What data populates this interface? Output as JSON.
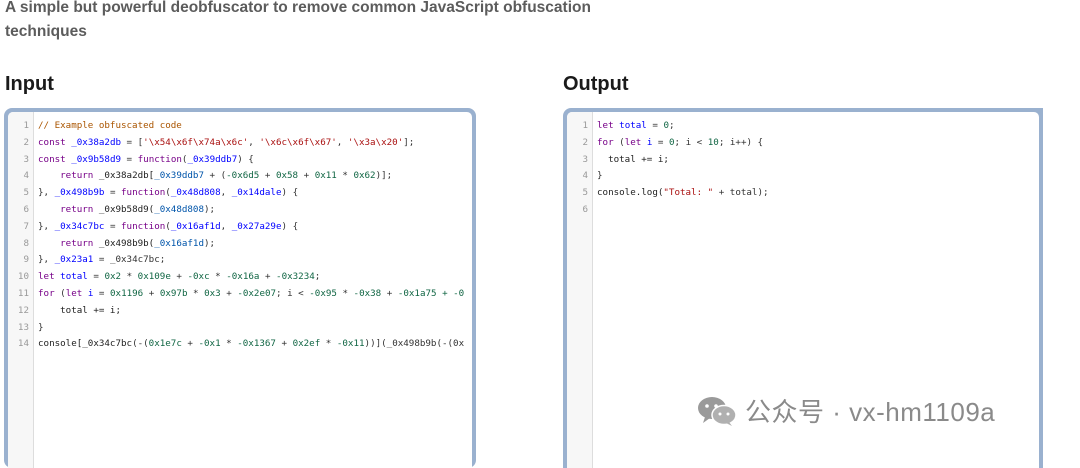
{
  "subtitle": "A simple but powerful deobfuscator to remove common JavaScript obfuscation techniques",
  "input_panel": {
    "heading": "Input",
    "line_numbers": [
      "1",
      "2",
      "3",
      "4",
      "5",
      "6",
      "7",
      "8",
      "9",
      "10",
      "11",
      "12",
      "13",
      "14"
    ],
    "lines": [
      [
        {
          "t": "// Example obfuscated code",
          "c": "com"
        }
      ],
      [
        {
          "t": "const",
          "c": "kw"
        },
        {
          "t": " ",
          "c": "pun"
        },
        {
          "t": "_0x38a2db",
          "c": "def"
        },
        {
          "t": " = [",
          "c": "pun"
        },
        {
          "t": "'\\x54\\x6f\\x74a\\x6c'",
          "c": "str"
        },
        {
          "t": ", ",
          "c": "pun"
        },
        {
          "t": "'\\x6c\\x6f\\x67'",
          "c": "str"
        },
        {
          "t": ", ",
          "c": "pun"
        },
        {
          "t": "'\\x3a\\x20'",
          "c": "str"
        },
        {
          "t": "];",
          "c": "pun"
        }
      ],
      [
        {
          "t": "const",
          "c": "kw"
        },
        {
          "t": " ",
          "c": "pun"
        },
        {
          "t": "_0x9b58d9",
          "c": "def"
        },
        {
          "t": " = ",
          "c": "pun"
        },
        {
          "t": "function",
          "c": "kw"
        },
        {
          "t": "(",
          "c": "pun"
        },
        {
          "t": "_0x39ddb7",
          "c": "def"
        },
        {
          "t": ") {",
          "c": "pun"
        }
      ],
      [
        {
          "t": "    ",
          "c": "pun"
        },
        {
          "t": "return",
          "c": "kw"
        },
        {
          "t": " _0x38a2db[",
          "c": "var"
        },
        {
          "t": "_0x39ddb7",
          "c": "var2"
        },
        {
          "t": " + (",
          "c": "pun"
        },
        {
          "t": "-0x6d5",
          "c": "num"
        },
        {
          "t": " + ",
          "c": "pun"
        },
        {
          "t": "0x58",
          "c": "num"
        },
        {
          "t": " + ",
          "c": "pun"
        },
        {
          "t": "0x11",
          "c": "num"
        },
        {
          "t": " * ",
          "c": "pun"
        },
        {
          "t": "0x62",
          "c": "num"
        },
        {
          "t": ")];",
          "c": "pun"
        }
      ],
      [
        {
          "t": "}, ",
          "c": "pun"
        },
        {
          "t": "_0x498b9b",
          "c": "def"
        },
        {
          "t": " = ",
          "c": "pun"
        },
        {
          "t": "function",
          "c": "kw"
        },
        {
          "t": "(",
          "c": "pun"
        },
        {
          "t": "_0x48d808",
          "c": "def"
        },
        {
          "t": ", ",
          "c": "pun"
        },
        {
          "t": "_0x14dale",
          "c": "def"
        },
        {
          "t": ") {",
          "c": "pun"
        }
      ],
      [
        {
          "t": "    ",
          "c": "pun"
        },
        {
          "t": "return",
          "c": "kw"
        },
        {
          "t": " _0x9b58d9(",
          "c": "var"
        },
        {
          "t": "_0x48d808",
          "c": "var2"
        },
        {
          "t": ");",
          "c": "pun"
        }
      ],
      [
        {
          "t": "}, ",
          "c": "pun"
        },
        {
          "t": "_0x34c7bc",
          "c": "def"
        },
        {
          "t": " = ",
          "c": "pun"
        },
        {
          "t": "function",
          "c": "kw"
        },
        {
          "t": "(",
          "c": "pun"
        },
        {
          "t": "_0x16af1d",
          "c": "def"
        },
        {
          "t": ", ",
          "c": "pun"
        },
        {
          "t": "_0x27a29e",
          "c": "def"
        },
        {
          "t": ") {",
          "c": "pun"
        }
      ],
      [
        {
          "t": "    ",
          "c": "pun"
        },
        {
          "t": "return",
          "c": "kw"
        },
        {
          "t": " _0x498b9b(",
          "c": "var"
        },
        {
          "t": "_0x16af1d",
          "c": "var2"
        },
        {
          "t": ");",
          "c": "pun"
        }
      ],
      [
        {
          "t": "}, ",
          "c": "pun"
        },
        {
          "t": "_0x23a1",
          "c": "def"
        },
        {
          "t": " = _0x34c7bc;",
          "c": "pun"
        }
      ],
      [
        {
          "t": "let",
          "c": "kw"
        },
        {
          "t": " ",
          "c": "pun"
        },
        {
          "t": "total",
          "c": "def"
        },
        {
          "t": " = ",
          "c": "pun"
        },
        {
          "t": "0x2",
          "c": "num"
        },
        {
          "t": " * ",
          "c": "pun"
        },
        {
          "t": "0x109e",
          "c": "num"
        },
        {
          "t": " + ",
          "c": "pun"
        },
        {
          "t": "-0xc",
          "c": "num"
        },
        {
          "t": " * ",
          "c": "pun"
        },
        {
          "t": "-0x16a",
          "c": "num"
        },
        {
          "t": " + ",
          "c": "pun"
        },
        {
          "t": "-0x3234",
          "c": "num"
        },
        {
          "t": ";",
          "c": "pun"
        }
      ],
      [
        {
          "t": "for",
          "c": "kw"
        },
        {
          "t": " (",
          "c": "pun"
        },
        {
          "t": "let",
          "c": "kw"
        },
        {
          "t": " ",
          "c": "pun"
        },
        {
          "t": "i",
          "c": "def"
        },
        {
          "t": " = ",
          "c": "pun"
        },
        {
          "t": "0x1196",
          "c": "num"
        },
        {
          "t": " + ",
          "c": "pun"
        },
        {
          "t": "0x97b",
          "c": "num"
        },
        {
          "t": " * ",
          "c": "pun"
        },
        {
          "t": "0x3",
          "c": "num"
        },
        {
          "t": " + ",
          "c": "pun"
        },
        {
          "t": "-0x2e07",
          "c": "num"
        },
        {
          "t": "; i < ",
          "c": "pun"
        },
        {
          "t": "-0x95",
          "c": "num"
        },
        {
          "t": " * ",
          "c": "pun"
        },
        {
          "t": "-0x38",
          "c": "num"
        },
        {
          "t": " + ",
          "c": "pun"
        },
        {
          "t": "-0x1a75",
          "c": "num"
        },
        {
          "t": " + -0",
          "c": "num"
        }
      ],
      [
        {
          "t": "    total += i;",
          "c": "var"
        }
      ],
      [
        {
          "t": "}",
          "c": "pun"
        }
      ],
      [
        {
          "t": "console[",
          "c": "var"
        },
        {
          "t": "_0x34c7bc",
          "c": "var"
        },
        {
          "t": "(-(",
          "c": "pun"
        },
        {
          "t": "0x1e7c",
          "c": "num"
        },
        {
          "t": " + ",
          "c": "pun"
        },
        {
          "t": "-0x1",
          "c": "num"
        },
        {
          "t": " * ",
          "c": "pun"
        },
        {
          "t": "-0x1367",
          "c": "num"
        },
        {
          "t": " + ",
          "c": "pun"
        },
        {
          "t": "0x2ef",
          "c": "num"
        },
        {
          "t": " * ",
          "c": "pun"
        },
        {
          "t": "-0x11",
          "c": "num"
        },
        {
          "t": "))](_0x498b9b(-(0x",
          "c": "pun"
        }
      ]
    ]
  },
  "output_panel": {
    "heading": "Output",
    "line_numbers": [
      "1",
      "2",
      "3",
      "4",
      "5",
      "6"
    ],
    "lines": [
      [
        {
          "t": "let",
          "c": "kw"
        },
        {
          "t": " ",
          "c": "pun"
        },
        {
          "t": "total",
          "c": "def"
        },
        {
          "t": " = ",
          "c": "pun"
        },
        {
          "t": "0",
          "c": "num"
        },
        {
          "t": ";",
          "c": "pun"
        }
      ],
      [
        {
          "t": "for",
          "c": "kw"
        },
        {
          "t": " (",
          "c": "pun"
        },
        {
          "t": "let",
          "c": "kw"
        },
        {
          "t": " ",
          "c": "pun"
        },
        {
          "t": "i",
          "c": "def"
        },
        {
          "t": " = ",
          "c": "pun"
        },
        {
          "t": "0",
          "c": "num"
        },
        {
          "t": "; i < ",
          "c": "pun"
        },
        {
          "t": "10",
          "c": "num"
        },
        {
          "t": "; i++) {",
          "c": "pun"
        }
      ],
      [
        {
          "t": "  total += i;",
          "c": "var"
        }
      ],
      [
        {
          "t": "}",
          "c": "pun"
        }
      ],
      [
        {
          "t": "console.log(",
          "c": "var"
        },
        {
          "t": "\"Total: \"",
          "c": "str"
        },
        {
          "t": " + total);",
          "c": "pun"
        }
      ],
      [
        {
          "t": "",
          "c": "pun"
        }
      ]
    ]
  },
  "watermark": {
    "icon": "wechat-icon",
    "text": "公众号 · vx-hm1109a"
  }
}
